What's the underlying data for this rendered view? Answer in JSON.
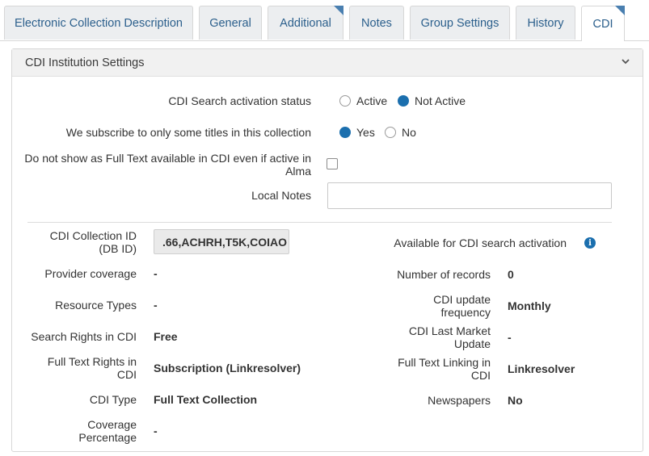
{
  "tabs": [
    {
      "label": "Electronic Collection Description"
    },
    {
      "label": "General"
    },
    {
      "label": "Additional"
    },
    {
      "label": "Notes"
    },
    {
      "label": "Group Settings"
    },
    {
      "label": "History"
    },
    {
      "label": "CDI"
    }
  ],
  "active_tab": "CDI",
  "panel": {
    "title": "CDI Institution Settings"
  },
  "form": {
    "activation_label": "CDI Search activation status",
    "activation_options": [
      "Active",
      "Not Active"
    ],
    "activation_selected": "Not Active",
    "subscribe_label": "We subscribe to only some titles in this collection",
    "subscribe_options": [
      "Yes",
      "No"
    ],
    "subscribe_selected": "Yes",
    "fulltext_label_line1": "Do not show as Full Text available in CDI even if active in",
    "fulltext_label_line2": "Alma",
    "fulltext_checked": false,
    "local_notes_label": "Local Notes",
    "local_notes_value": ""
  },
  "details": {
    "collection_id_label_line1": "CDI Collection ID",
    "collection_id_label_line2": "(DB ID)",
    "collection_id_value": ".66,ACHRH,T5K,COIAO",
    "available_label": "Available for CDI search activation",
    "provider_coverage_label": "Provider coverage",
    "provider_coverage_value": "-",
    "records_label": "Number of records",
    "records_value": "0",
    "resource_types_label": "Resource Types",
    "resource_types_value": "-",
    "update_freq_label_line1": "CDI update",
    "update_freq_label_line2": "frequency",
    "update_freq_value": "Monthly",
    "search_rights_label": "Search Rights in CDI",
    "search_rights_value": "Free",
    "last_market_label_line1": "CDI Last Market",
    "last_market_label_line2": "Update",
    "last_market_value": "-",
    "fulltext_rights_label_line1": "Full Text Rights in",
    "fulltext_rights_label_line2": "CDI",
    "fulltext_rights_value": "Subscription (Linkresolver)",
    "fulltext_linking_label_line1": "Full Text Linking in",
    "fulltext_linking_label_line2": "CDI",
    "fulltext_linking_value": "Linkresolver",
    "cdi_type_label": "CDI Type",
    "cdi_type_value": "Full Text Collection",
    "newspapers_label": "Newspapers",
    "newspapers_value": "No",
    "coverage_pct_label_line1": "Coverage",
    "coverage_pct_label_line2": "Percentage",
    "coverage_pct_value": "-"
  },
  "icons": {
    "collapse": "chevron-down-icon",
    "info": "info-icon",
    "info_glyph": "i"
  },
  "colors": {
    "accent": "#1b6fae",
    "tab_text": "#2b5f8c",
    "tab_corner": "#4a7fb0"
  }
}
